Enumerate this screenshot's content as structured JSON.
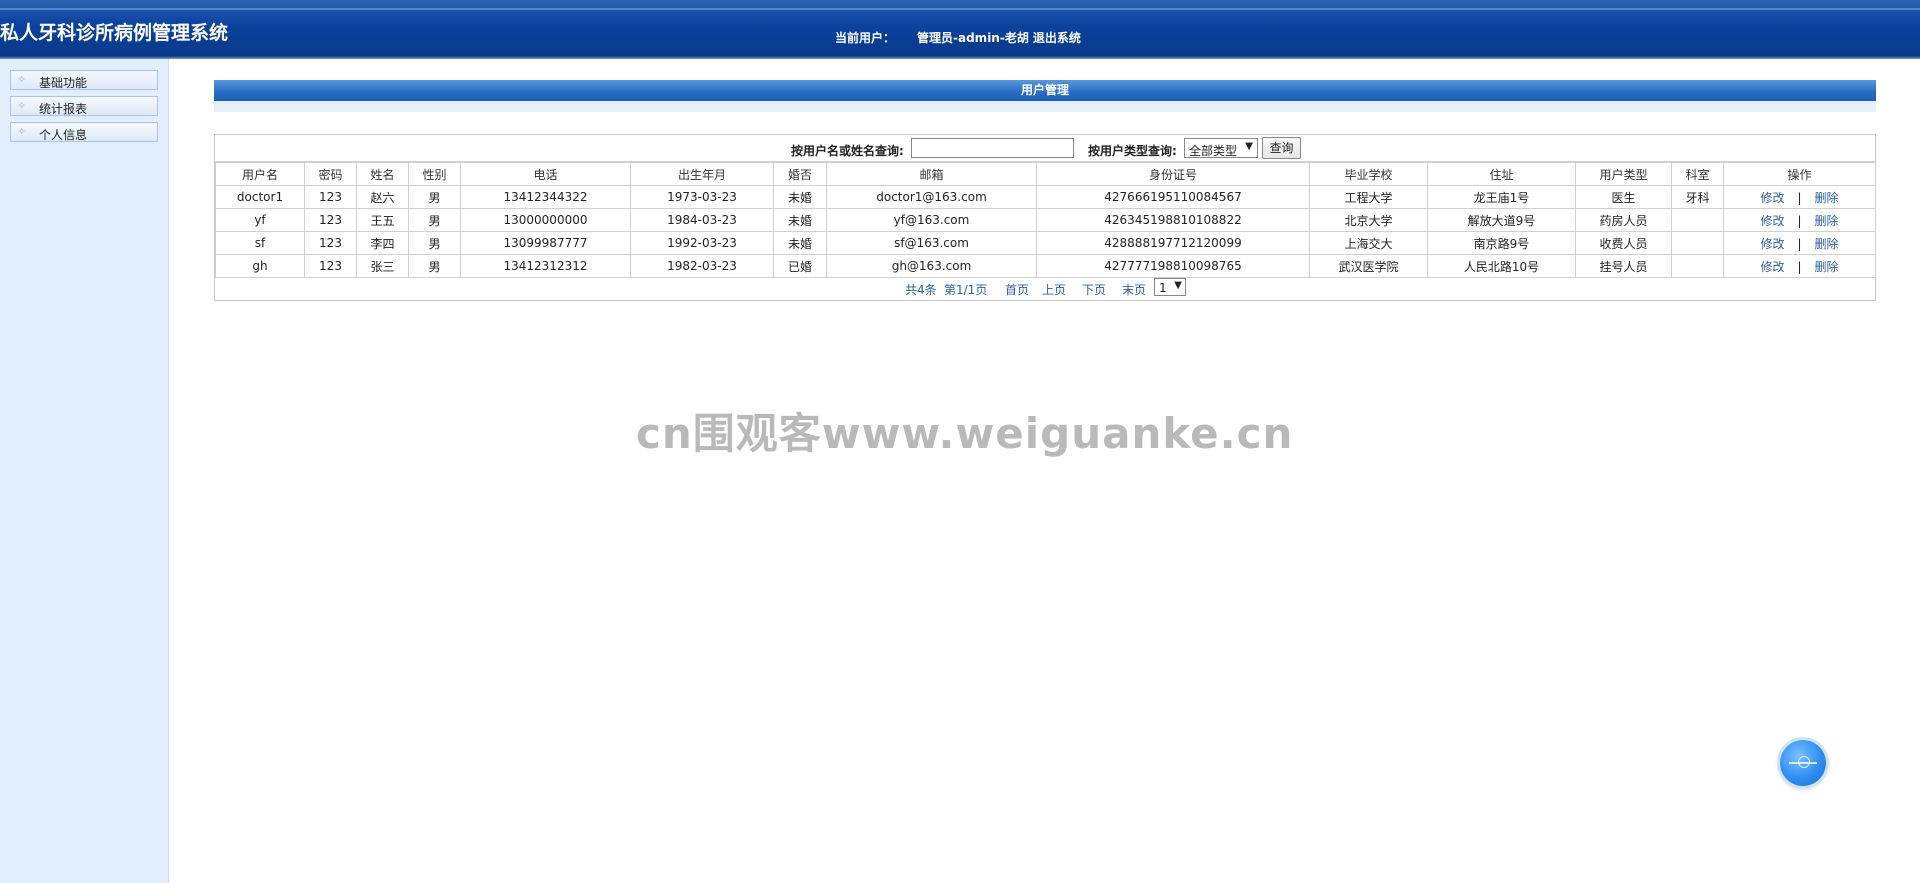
{
  "header": {
    "app_title": "私人牙科诊所病例管理系统",
    "current_user_label": "当前用户：",
    "current_user": "管理员-admin-老胡",
    "logout": "退出系统"
  },
  "sidebar": {
    "items": [
      {
        "label": "基础功能"
      },
      {
        "label": "统计报表"
      },
      {
        "label": "个人信息"
      }
    ]
  },
  "panel": {
    "title": "用户管理"
  },
  "search": {
    "name_label": "按用户名或姓名查询:",
    "name_value": "",
    "type_label": "按用户类型查询:",
    "type_selected": "全部类型",
    "button": "查询"
  },
  "table": {
    "columns": [
      "用户名",
      "密码",
      "姓名",
      "性别",
      "电话",
      "出生年月",
      "婚否",
      "邮箱",
      "身份证号",
      "毕业学校",
      "住址",
      "用户类型",
      "科室",
      "操作"
    ],
    "rows": [
      [
        "doctor1",
        "123",
        "赵六",
        "男",
        "13412344322",
        "1973-03-23",
        "未婚",
        "doctor1@163.com",
        "427666195110084567",
        "工程大学",
        "龙王庙1号",
        "医生",
        "牙科"
      ],
      [
        "yf",
        "123",
        "王五",
        "男",
        "13000000000",
        "1984-03-23",
        "未婚",
        "yf@163.com",
        "426345198810108822",
        "北京大学",
        "解放大道9号",
        "药房人员",
        ""
      ],
      [
        "sf",
        "123",
        "李四",
        "男",
        "13099987777",
        "1992-03-23",
        "未婚",
        "sf@163.com",
        "428888197712120099",
        "上海交大",
        "南京路9号",
        "收费人员",
        ""
      ],
      [
        "gh",
        "123",
        "张三",
        "男",
        "13412312312",
        "1982-03-23",
        "已婚",
        "gh@163.com",
        "427777198810098765",
        "武汉医学院",
        "人民北路10号",
        "挂号人员",
        ""
      ]
    ],
    "edit_label": "修改",
    "sep": "|",
    "delete_label": "删除"
  },
  "pager": {
    "total": "共4条",
    "page_info": "第1/1页",
    "first": "首页",
    "prev": "上页",
    "next": "下页",
    "last": "末页",
    "page_selected": "1"
  },
  "watermark": "cn围观客www.weiguanke.cn",
  "colors": {
    "header": "#0a3d94",
    "sidebar_bg": "#e2eefc",
    "panel_title": "#2a6fc5",
    "link": "#2c5f9e"
  }
}
